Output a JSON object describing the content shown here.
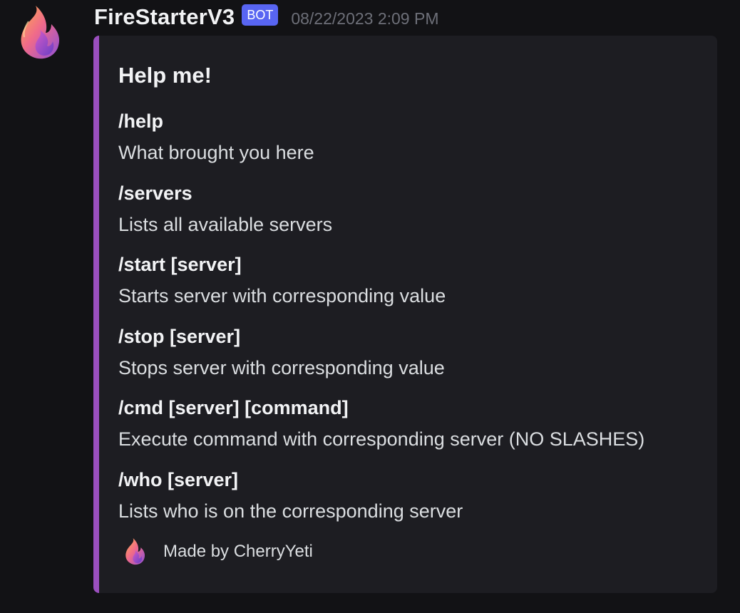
{
  "message": {
    "author": {
      "username": "FireStarterV3",
      "tag": "BOT",
      "avatar_icon": "flame-avatar-icon"
    },
    "timestamp": "08/22/2023 2:09 PM",
    "embed": {
      "accent_color": "#9a4fbe",
      "title": "Help me!",
      "fields": [
        {
          "name": "/help",
          "value": "What brought you here"
        },
        {
          "name": "/servers",
          "value": "Lists all available servers"
        },
        {
          "name": "/start [server]",
          "value": "Starts server with corresponding value"
        },
        {
          "name": "/stop [server]",
          "value": "Stops server with corresponding value"
        },
        {
          "name": "/cmd [server] [command]",
          "value": "Execute command with corresponding server (NO SLASHES)"
        },
        {
          "name": "/who [server]",
          "value": "Lists who is on the corresponding server"
        }
      ],
      "footer": {
        "icon": "flame-icon",
        "text": "Made by CherryYeti"
      }
    }
  },
  "colors": {
    "background": "#121215",
    "embed_background": "#1d1d22",
    "bot_tag": "#5865f2",
    "timestamp": "#6d6f78"
  }
}
